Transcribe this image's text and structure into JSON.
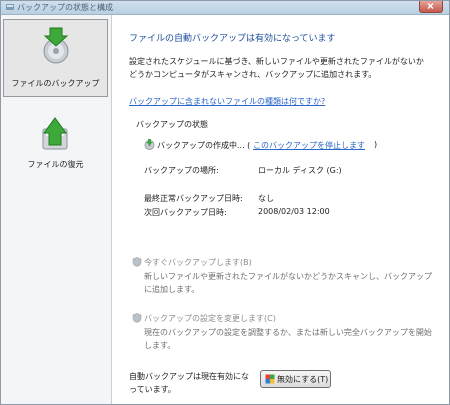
{
  "window": {
    "title": "バックアップの状態と構成",
    "close_icon": "close-icon"
  },
  "sidebar": {
    "items": [
      {
        "label": "ファイルのバックアップ",
        "icon": "backup-disk-icon",
        "active": true
      },
      {
        "label": "ファイルの復元",
        "icon": "restore-disk-icon",
        "active": false
      }
    ]
  },
  "main": {
    "header": "ファイルの自動バックアップは有効になっています",
    "description_line1": "設定されたスケジュールに基づき、新しいファイルや更新されたファイルがないか",
    "description_line2": "どうかコンピュータがスキャンされ、バックアップに追加されます。",
    "help_link": "バックアップに含まれないファイルの種類は何ですか?",
    "status_title": "バックアップの状態",
    "status_text": "バックアップの作成中... (",
    "stop_link": "このバックアップを停止します",
    "status_close_paren": ")",
    "location_label": "バックアップの場所:",
    "location_value": "ローカル ディスク (G:)",
    "last_backup_label": "最終正常バックアップ日時:",
    "last_backup_value": "なし",
    "next_backup_label": "次回バックアップ日時:",
    "next_backup_value": "2008/02/03 12:00",
    "backup_now_title": "今すぐバックアップします(B)",
    "backup_now_desc_line1": "新しいファイルや更新されたファイルがないかどうかスキャンし、バックアップ",
    "backup_now_desc_line2": "に追加します。",
    "change_settings_title": "バックアップの設定を変更します(C)",
    "change_settings_desc_line1": "現在のバックアップの設定を調整するか、または新しい完全バックアップを開始",
    "change_settings_desc_line2": "します。",
    "auto_status_line1": "自動バックアップは現在有効にな",
    "auto_status_line2": "っています。",
    "disable_button": "無効にする(T)"
  }
}
